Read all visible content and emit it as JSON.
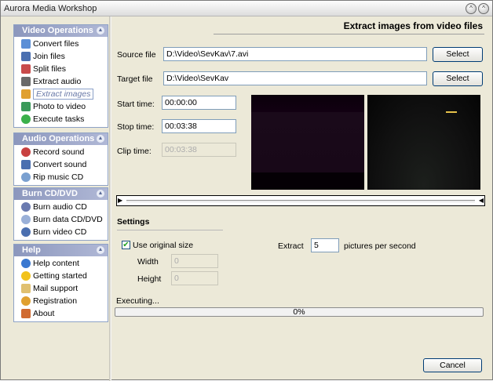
{
  "window": {
    "title": "Aurora Media Workshop"
  },
  "sidebar": {
    "video_operations": {
      "title": "Video Operations",
      "items": [
        {
          "label": "Convert files",
          "icon": "convert-files-icon"
        },
        {
          "label": "Join files",
          "icon": "join-files-icon"
        },
        {
          "label": "Split files",
          "icon": "split-files-icon"
        },
        {
          "label": "Extract audio",
          "icon": "extract-audio-icon"
        },
        {
          "label": "Extract images",
          "icon": "extract-images-icon"
        },
        {
          "label": "Photo to video",
          "icon": "photo-to-video-icon"
        },
        {
          "label": "Execute tasks",
          "icon": "execute-tasks-icon"
        }
      ]
    },
    "audio_operations": {
      "title": "Audio Operations",
      "items": [
        {
          "label": "Record sound",
          "icon": "record-sound-icon"
        },
        {
          "label": "Convert sound",
          "icon": "convert-sound-icon"
        },
        {
          "label": "Rip music CD",
          "icon": "rip-music-cd-icon"
        }
      ]
    },
    "burn_cd": {
      "title": "Burn CD/DVD",
      "items": [
        {
          "label": "Burn audio CD",
          "icon": "burn-audio-cd-icon"
        },
        {
          "label": "Burn data CD/DVD",
          "icon": "burn-data-cd-icon"
        },
        {
          "label": "Burn video CD",
          "icon": "burn-video-cd-icon"
        }
      ]
    },
    "help": {
      "title": "Help",
      "items": [
        {
          "label": "Help content",
          "icon": "help-content-icon"
        },
        {
          "label": "Getting started",
          "icon": "getting-started-icon"
        },
        {
          "label": "Mail support",
          "icon": "mail-support-icon"
        },
        {
          "label": "Registration",
          "icon": "registration-icon"
        },
        {
          "label": "About",
          "icon": "about-icon"
        }
      ]
    }
  },
  "main": {
    "header_title": "Extract images from video files",
    "source_file_label": "Source file",
    "source_file_value": "D:\\Video\\SevKav\\7.avi",
    "target_file_label": "Target file",
    "target_file_value": "D:\\Video\\SevKav",
    "select_label": "Select",
    "start_time_label": "Start time:",
    "start_time_value": "00:00:00",
    "stop_time_label": "Stop time:",
    "stop_time_value": "00:03:38",
    "clip_time_label": "Clip time:",
    "clip_time_value": "00:03:38",
    "settings_label": "Settings",
    "use_original_size_label": "Use original size",
    "use_original_size_checked": true,
    "width_label": "Width",
    "width_value": "0",
    "height_label": "Height",
    "height_value": "0",
    "extract_label": "Extract",
    "extract_value": "5",
    "pictures_per_second_label": "pictures per second",
    "executing_label": "Executing...",
    "progress_text": "0%",
    "progress_fraction": 0,
    "cancel_label": "Cancel"
  },
  "colors": {
    "panel_header": "#8c97bd",
    "background": "#ece9d8",
    "accent_border": "#7f9db9"
  }
}
